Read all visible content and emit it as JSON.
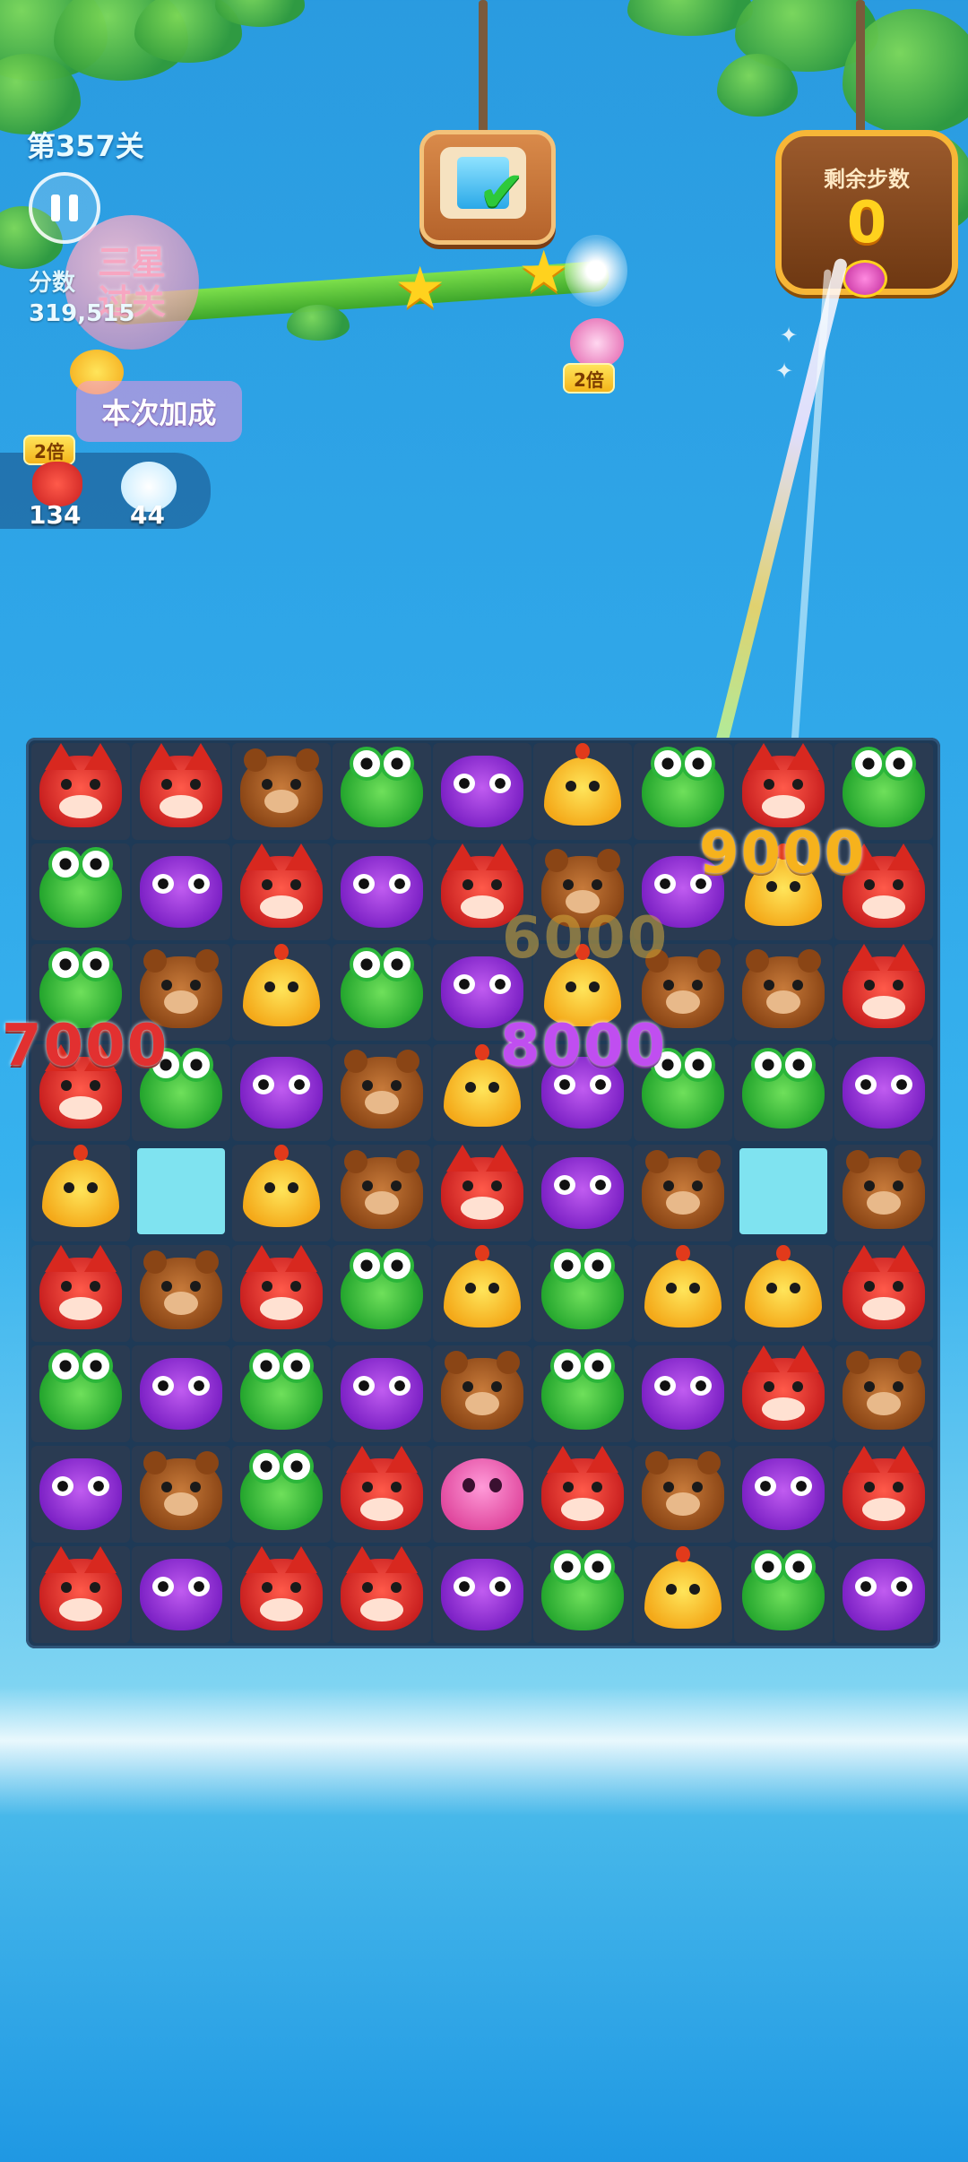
{
  "hud": {
    "level": "第357关",
    "score_label": "分数",
    "score_value": "319,515",
    "three_star_line1": "三星",
    "three_star_line2": "过关",
    "bonus_label": "本次加成",
    "bonus_mult_fox": "2倍",
    "bonus_count_fox": "134",
    "bonus_count_bird": "44"
  },
  "goal": {
    "status": "complete",
    "mult": "2倍"
  },
  "stars": {
    "earned": 2,
    "total": 3
  },
  "moves": {
    "label": "剩余步数",
    "value": "0"
  },
  "popups": {
    "p7000": "7000",
    "p8000": "8000",
    "p9000": "9000",
    "p6000": "6000"
  },
  "colors": {
    "fox": "#d8281f",
    "frog": "#2bb63a",
    "bear": "#8a4515",
    "owl": "#8a2bd0",
    "chick": "#f4c02a",
    "octopus": "#e0489e",
    "hole": "#7fe3f0"
  },
  "board": [
    [
      "fox",
      "fox",
      "bear",
      "frog",
      "owl",
      "chick",
      "frog",
      "fox",
      "frog"
    ],
    [
      "frog",
      "owl",
      "fox",
      "owl",
      "fox",
      "bear",
      "owl",
      "chick",
      "fox"
    ],
    [
      "frog",
      "bear",
      "chick",
      "frog",
      "owl",
      "chick",
      "bear",
      "bear",
      "fox"
    ],
    [
      "fox",
      "frog",
      "owl",
      "bear",
      "chick",
      "owl",
      "frog",
      "frog",
      "owl"
    ],
    [
      "chick",
      "hole",
      "chick",
      "bear",
      "fox",
      "owl",
      "bear",
      "hole",
      "bear"
    ],
    [
      "fox",
      "bear",
      "fox",
      "frog",
      "chick",
      "frog",
      "chick",
      "chick",
      "fox"
    ],
    [
      "frog",
      "owl",
      "frog",
      "owl",
      "bear",
      "frog",
      "owl",
      "fox",
      "bear"
    ],
    [
      "owl",
      "bear",
      "frog",
      "fox",
      "octopus",
      "fox",
      "bear",
      "owl",
      "fox"
    ],
    [
      "fox",
      "owl",
      "fox",
      "fox",
      "owl",
      "frog",
      "chick",
      "frog",
      "owl"
    ]
  ]
}
